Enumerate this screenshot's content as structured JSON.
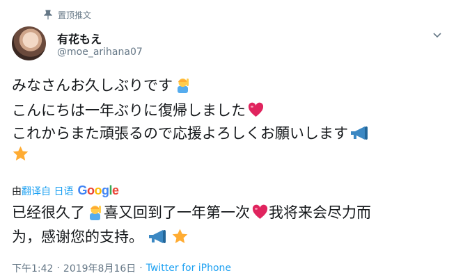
{
  "pinned": {
    "label": "置顶推文",
    "icon": "pin-icon"
  },
  "author": {
    "display_name": "有花もえ",
    "handle": "@moe_arihana07",
    "avatar": "avatar"
  },
  "tweet": {
    "lines": [
      "みなさんお久しぶりです",
      "こんにちは一年ぶりに復帰しました",
      "これからまた頑張るので応援よろしくお願いします"
    ],
    "emojis": [
      "man-raising-hand-emoji",
      "heart-emoji",
      "megaphone-emoji",
      "star-emoji"
    ]
  },
  "translation_bar": {
    "prefix": "由",
    "link": "翻译自 日语",
    "provider": [
      "G",
      "o",
      "o",
      "g",
      "l",
      "e"
    ],
    "provider_colors": [
      "#4285f4",
      "#ea4335",
      "#fbbc05",
      "#4285f4",
      "#34a853",
      "#ea4335"
    ]
  },
  "translation": {
    "line1_part1": "已经很久了",
    "line1_part2": "喜又回到了一年第一次",
    "line1_part3": "我将来会尽力而",
    "line2": "为，感谢您的支持。"
  },
  "meta": {
    "time": "下午1:42",
    "separator": "·",
    "date": "2019年8月16日",
    "source": "Twitter for iPhone"
  },
  "colors": {
    "link": "#1da1f2",
    "muted": "#657786",
    "text": "#14171a",
    "heart": "#e0245e",
    "star": "#ffac33",
    "megaphone": "#3b88c3"
  }
}
